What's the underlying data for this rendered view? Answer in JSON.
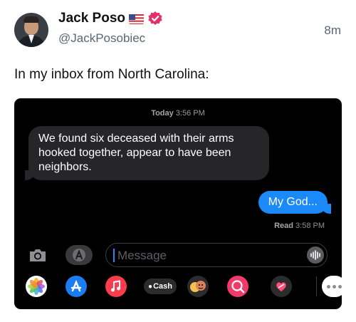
{
  "author": {
    "name": "Jack Poso",
    "handle": "@JackPosobiec",
    "time": "8m",
    "flag_icon": "us-flag-icon",
    "verified_icon": "verified-badge-icon",
    "verified_color": "#e1306c"
  },
  "tweet": {
    "text": "In my inbox from North Carolina:"
  },
  "screenshot": {
    "timestamp_day": "Today",
    "timestamp_time": "3:56 PM",
    "incoming_message": "We found six deceased with their arms hooked together, appear to have been neighbors.",
    "outgoing_message": "My God...",
    "read_label": "Read",
    "read_time": "3:58 PM",
    "input_placeholder": "Message",
    "cash_label": "Cash",
    "colors": {
      "bubble_out": "#1b8af8",
      "bubble_in": "#262629",
      "background": "#000000"
    },
    "app_icons": [
      "photos-icon",
      "app-store-icon",
      "music-icon",
      "apple-cash-icon",
      "memoji-icon",
      "image-search-icon",
      "digital-touch-icon",
      "more-apps-icon"
    ]
  }
}
